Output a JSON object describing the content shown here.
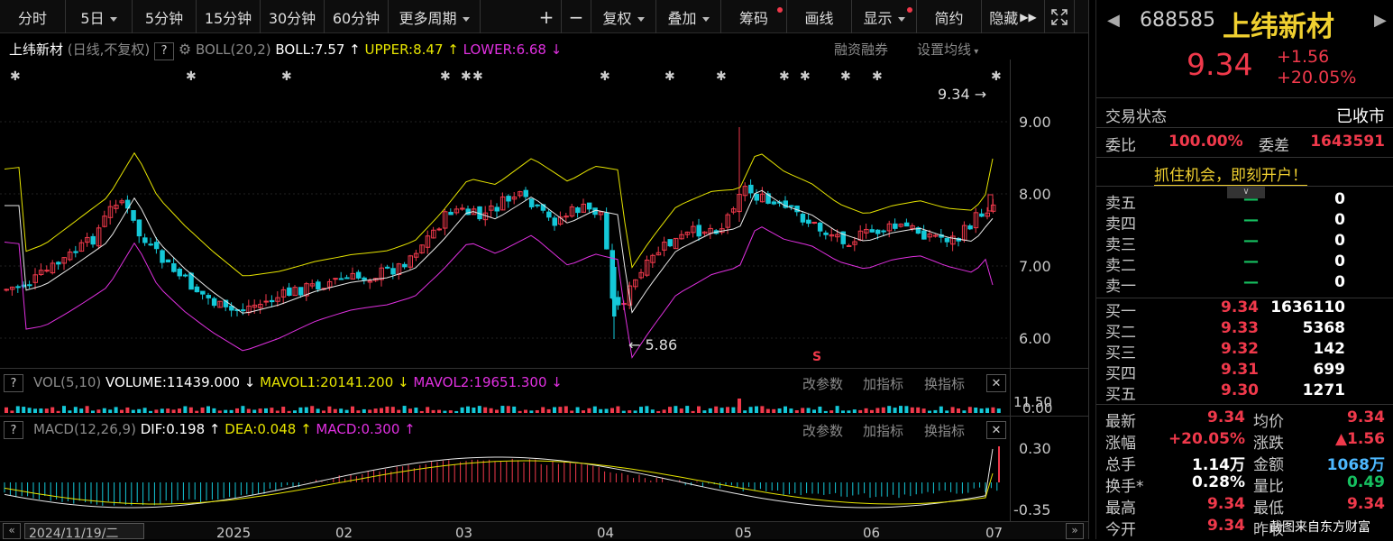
{
  "toolbar": {
    "periods": [
      "分时",
      "5日",
      "5分钟",
      "15分钟",
      "30分钟",
      "60分钟",
      "更多周期"
    ],
    "plus": "+",
    "minus": "−",
    "fq": "复权",
    "overlay": "叠加",
    "chips": "筹码",
    "line": "画线",
    "display": "显示",
    "simple": "简约",
    "hide": "隐藏"
  },
  "stock": {
    "code": "688585",
    "name": "上纬新材",
    "price": "9.34",
    "change": "+1.56",
    "pct": "+20.05%"
  },
  "main": {
    "name": "上纬新材",
    "mode": "(日线,不复权)",
    "help": "?",
    "indicator": "BOLL(20,2)",
    "boll": "BOLL:7.57",
    "upper": "UPPER:8.47",
    "lower": "LOWER:6.68",
    "rzrq": "融资融券",
    "setma": "设置均线",
    "last_price_label": "9.34",
    "low_label": "5.86",
    "s_marker": "S"
  },
  "yaxis": [
    "9.00",
    "8.00",
    "7.00",
    "6.00"
  ],
  "vol": {
    "name": "VOL(5,10)",
    "volume": "VOLUME:11439.000",
    "mavol1": "MAVOL1:20141.200",
    "mavol2": "MAVOL2:19651.300",
    "axis_top": "11.50",
    "axis_bottom": "0.00"
  },
  "macd": {
    "name": "MACD(12,26,9)",
    "dif": "DIF:0.198",
    "dea": "DEA:0.048",
    "macd": "MACD:0.300",
    "axis_top": "0.30",
    "axis_bottom": "-0.35"
  },
  "panel_btns": {
    "params": "改参数",
    "add": "加指标",
    "switch": "换指标",
    "close": "✕",
    "help": "?"
  },
  "xaxis": {
    "date": "2024/11/19/二",
    "labels": [
      "2025",
      "02",
      "03",
      "04",
      "05",
      "06",
      "07"
    ]
  },
  "right": {
    "status_label": "交易状态",
    "status": "已收市",
    "wb_label": "委比",
    "wb": "100.00%",
    "wc_label": "委差",
    "wc": "1643591",
    "promo": "抓住机会，即刻开户！",
    "asks": [
      {
        "l": "卖五",
        "p": "—",
        "v": "0"
      },
      {
        "l": "卖四",
        "p": "—",
        "v": "0"
      },
      {
        "l": "卖三",
        "p": "—",
        "v": "0"
      },
      {
        "l": "卖二",
        "p": "—",
        "v": "0"
      },
      {
        "l": "卖一",
        "p": "—",
        "v": "0"
      }
    ],
    "bids": [
      {
        "l": "买一",
        "p": "9.34",
        "v": "1636110"
      },
      {
        "l": "买二",
        "p": "9.33",
        "v": "5368"
      },
      {
        "l": "买三",
        "p": "9.32",
        "v": "142"
      },
      {
        "l": "买四",
        "p": "9.31",
        "v": "699"
      },
      {
        "l": "买五",
        "p": "9.30",
        "v": "1271"
      }
    ],
    "stats": [
      {
        "l1": "最新",
        "v1": "9.34",
        "l2": "均价",
        "v2": "9.34"
      },
      {
        "l1": "涨幅",
        "v1": "+20.05%",
        "l2": "涨跌",
        "v2": "▲1.56"
      },
      {
        "l1": "总手",
        "v1": "1.14万",
        "l2": "金额",
        "v2": "1068万"
      },
      {
        "l1": "换手*",
        "v1": "0.28%",
        "l2": "量比",
        "v2": "0.49"
      },
      {
        "l1": "最高",
        "v1": "9.34",
        "l2": "最低",
        "v2": "9.34"
      },
      {
        "l1": "今开",
        "v1": "9.34",
        "l2": "昨收",
        "v2": ""
      }
    ],
    "watermark": "截图来自东方财富"
  }
}
